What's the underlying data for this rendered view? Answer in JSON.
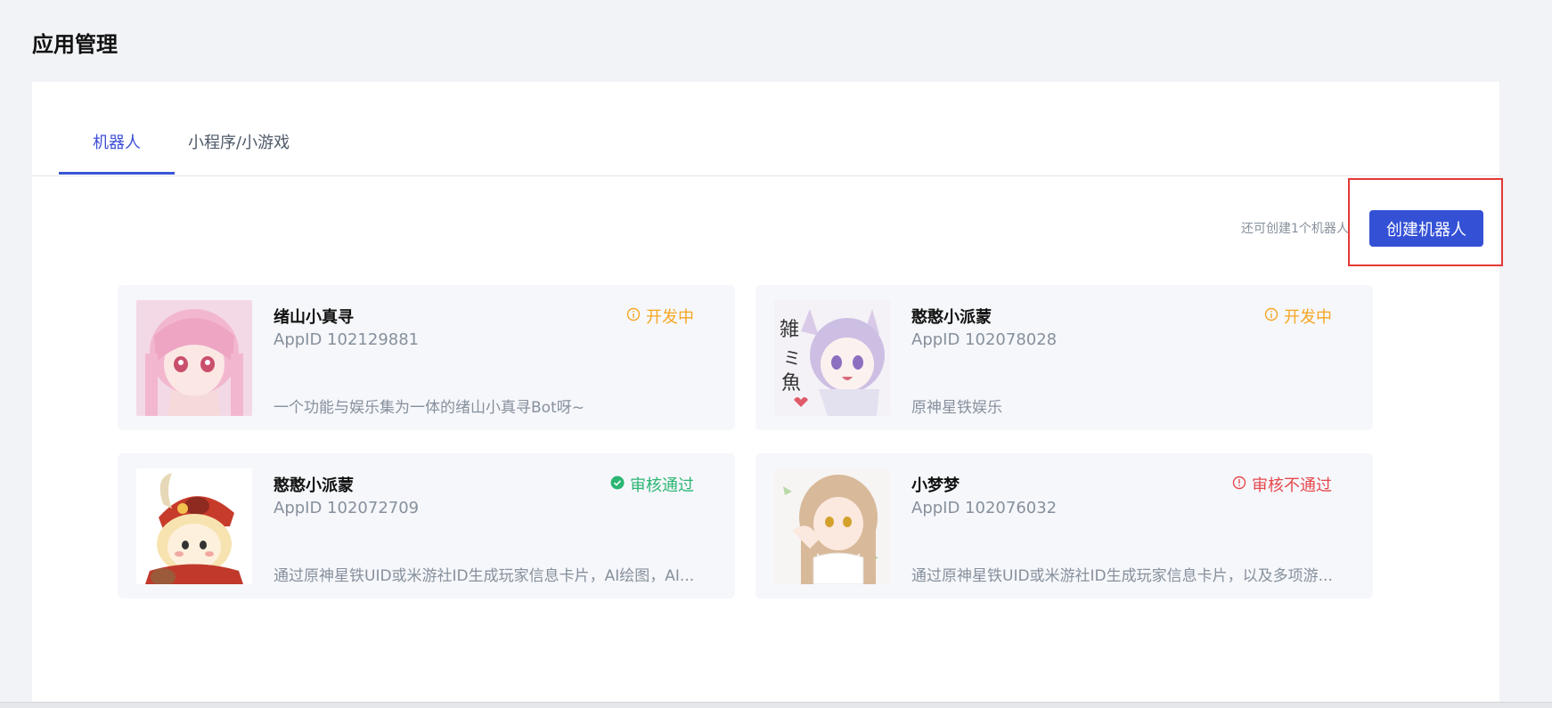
{
  "page": {
    "title": "应用管理"
  },
  "tabs": [
    {
      "label": "机器人"
    },
    {
      "label": "小程序/小游戏"
    }
  ],
  "toolbar": {
    "remaining_text": "还可创建1个机器人",
    "create_label": "创建机器人"
  },
  "colors": {
    "accent": "#3451d6",
    "status_dev": "#f5a623",
    "status_ok": "#2bb673",
    "status_fail": "#e5484d",
    "highlight": "#e53935"
  },
  "bots": [
    {
      "name": "绪山小真寻",
      "appid": "AppID 102129881",
      "status": "开发中",
      "status_type": "dev",
      "description": "一个功能与娱乐集为一体的绪山小真寻Bot呀~",
      "avatar": "avatar-pink-hair-girl"
    },
    {
      "name": "憨憨小派蒙",
      "appid": "AppID 102078028",
      "status": "开发中",
      "status_type": "dev",
      "description": "原神星铁娱乐",
      "avatar": "avatar-purple-hair-sketch"
    },
    {
      "name": "憨憨小派蒙",
      "appid": "AppID 102072709",
      "status": "审核通过",
      "status_type": "ok",
      "description": "通过原神星铁UID或米游社ID生成玩家信息卡片，AI绘图，AI...",
      "avatar": "avatar-red-hat-chibi"
    },
    {
      "name": "小梦梦",
      "appid": "AppID 102076032",
      "status": "审核不通过",
      "status_type": "fail",
      "description": "通过原神星铁UID或米游社ID生成玩家信息卡片，以及多项游...",
      "avatar": "avatar-brown-hair-girl"
    }
  ]
}
